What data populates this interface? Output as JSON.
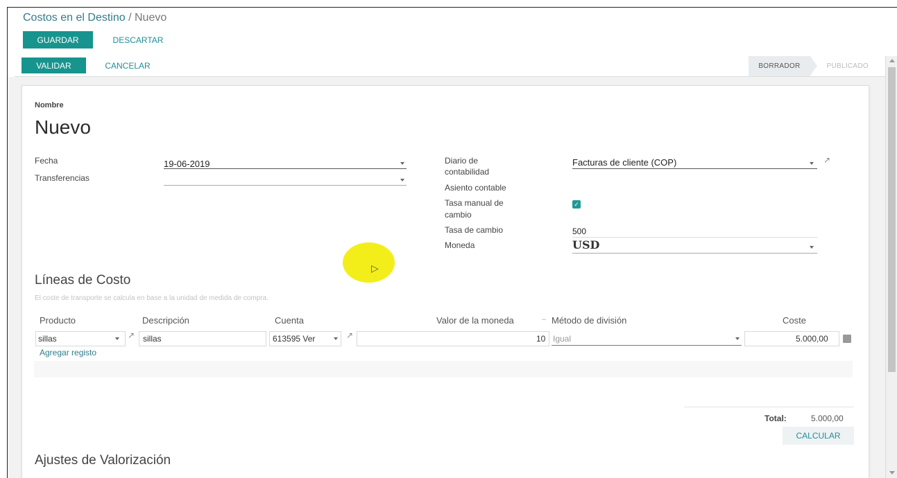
{
  "breadcrumb": {
    "parent": "Costos en el Destino",
    "separator": "/",
    "current": "Nuevo"
  },
  "buttons": {
    "save": "GUARDAR",
    "discard": "DESCARTAR",
    "validate": "VALIDAR",
    "cancel": "CANCELAR",
    "calculate": "CALCULAR"
  },
  "status": {
    "stages": [
      "BORRADOR",
      "PUBLICADO"
    ],
    "active": "BORRADOR"
  },
  "form": {
    "name_label": "Nombre",
    "name_value": "Nuevo",
    "fecha_label": "Fecha",
    "fecha_value": "19-06-2019",
    "transferencias_label": "Transferencias",
    "transferencias_value": "",
    "diario_label_1": "Diario de",
    "diario_label_2": "contabilidad",
    "diario_value": "Facturas de cliente (COP)",
    "asiento_label": "Asiento contable",
    "tasa_manual_label_1": "Tasa manual de",
    "tasa_manual_label_2": "cambio",
    "tasa_manual_checked": true,
    "tasa_cambio_label": "Tasa de cambio",
    "tasa_cambio_value": "500",
    "moneda_label": "Moneda",
    "moneda_value": "USD"
  },
  "cost_lines": {
    "title": "Líneas de Costo",
    "help": "El coste de transporte se calcula en base a la unidad de medida de compra.",
    "columns": {
      "producto": "Producto",
      "descripcion": "Descripción",
      "cuenta": "Cuenta",
      "valor": "Valor de la moneda",
      "metodo": "Método de división",
      "coste": "Coste"
    },
    "rows": [
      {
        "producto": "sillas",
        "descripcion": "sillas",
        "cuenta": "613595 Ver",
        "valor": "10",
        "metodo": "Igual",
        "coste": "5.000,00"
      }
    ],
    "add_record": "Agregar registo",
    "total_label": "Total:",
    "total_value": "5.000,00"
  },
  "valuation": {
    "title": "Ajustes de Valorización"
  },
  "colors": {
    "primary": "#18948e",
    "link": "#2f7c8c",
    "cursor_highlight": "#f3ee1a"
  }
}
